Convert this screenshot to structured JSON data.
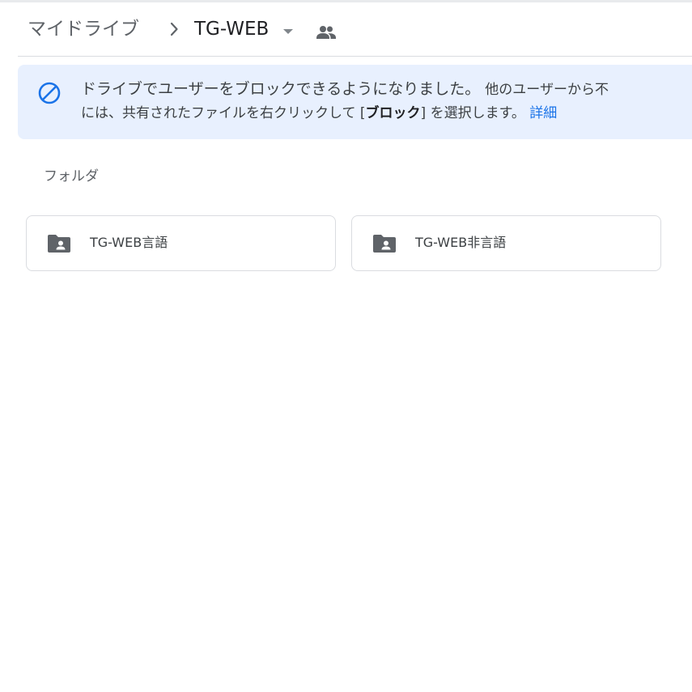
{
  "breadcrumb": {
    "root": "マイドライブ",
    "current": "TG-WEB",
    "separator_icon": "chevron-right-icon",
    "dropdown_icon": "arrow-drop-down-icon",
    "shared_icon": "people-icon"
  },
  "banner": {
    "icon": "block-icon",
    "line1_main": "ドライブでユーザーをブロックできるようになりました。",
    "line1_continued": "他のユーザーから不",
    "line2_prefix": "には、共有されたファイルを右クリックして [",
    "line2_bold": "ブロック",
    "line2_suffix": "] を選択します。",
    "link": "詳細",
    "colors": {
      "background": "#e8f0fe",
      "icon": "#1a73e8",
      "link": "#1a73e8"
    }
  },
  "folders": {
    "section_label": "フォルダ",
    "items": [
      {
        "name": "TG-WEB言語",
        "icon": "shared-folder-icon"
      },
      {
        "name": "TG-WEB非言語",
        "icon": "shared-folder-icon"
      }
    ]
  }
}
